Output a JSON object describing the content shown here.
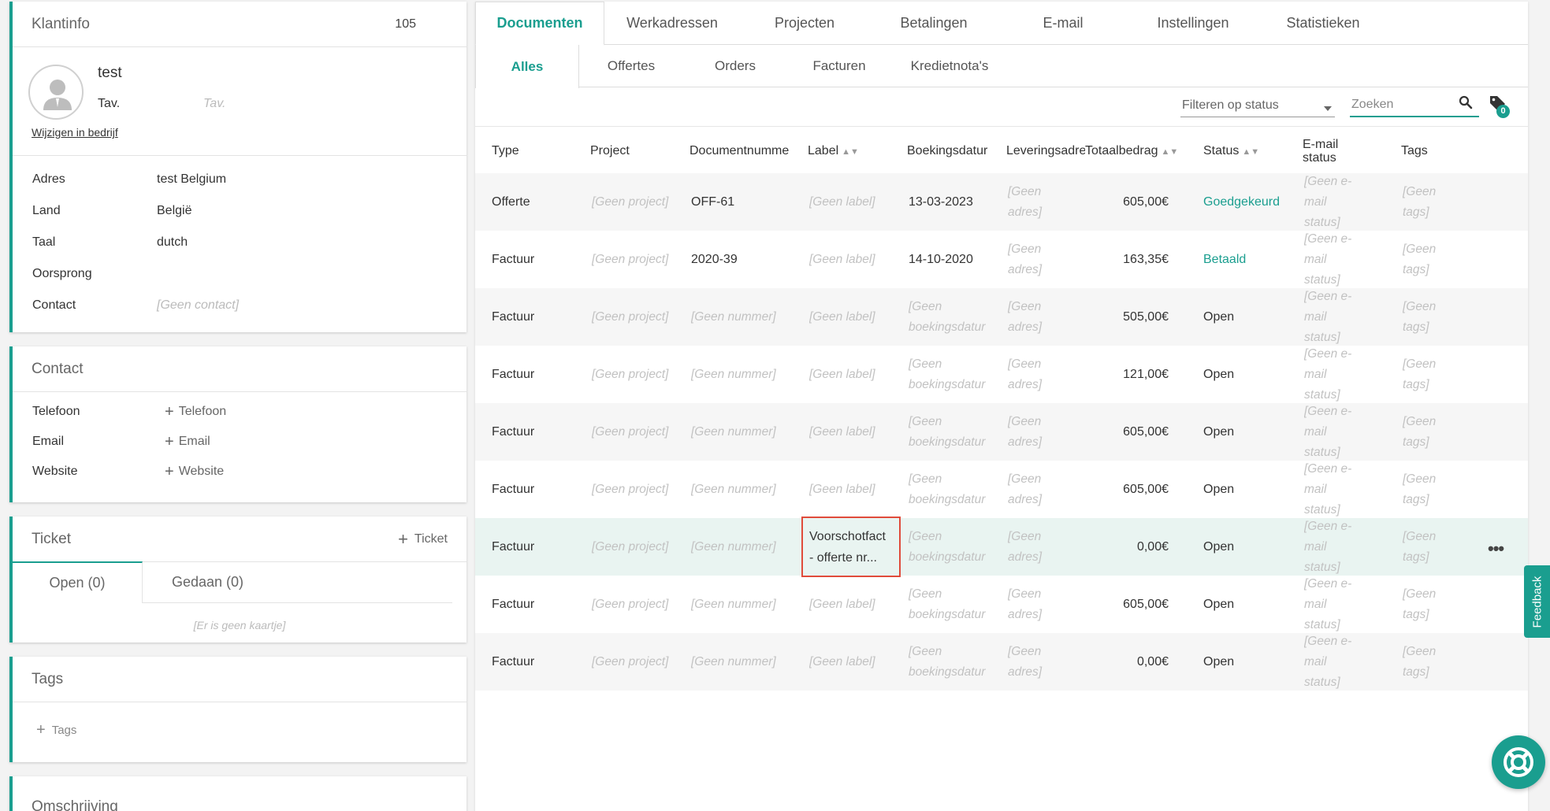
{
  "klantinfo": {
    "title": "Klantinfo",
    "number": "105",
    "name": "test",
    "tav_label": "Tav.",
    "tav_placeholder": "Tav.",
    "change_link": "Wijzigen in bedrijf",
    "fields": [
      {
        "key": "Adres",
        "value": "test Belgium"
      },
      {
        "key": "Land",
        "value": "België"
      },
      {
        "key": "Taal",
        "value": "dutch"
      },
      {
        "key": "Oorsprong",
        "value": ""
      },
      {
        "key": "Contact",
        "value": "[Geen contact]"
      }
    ]
  },
  "contact": {
    "title": "Contact",
    "rows": [
      {
        "key": "Telefoon",
        "add": "Telefoon"
      },
      {
        "key": "Email",
        "add": "Email"
      },
      {
        "key": "Website",
        "add": "Website"
      }
    ]
  },
  "ticket": {
    "title": "Ticket",
    "add_label": "Ticket",
    "tabs": [
      "Open (0)",
      "Gedaan (0)"
    ],
    "empty": "[Er is geen kaartje]"
  },
  "tags": {
    "title": "Tags",
    "add_label": "Tags"
  },
  "omschrijving": {
    "title": "Omschrijving"
  },
  "main_tabs": [
    "Documenten",
    "Werkadressen",
    "Projecten",
    "Betalingen",
    "E-mail",
    "Instellingen",
    "Statistieken"
  ],
  "sub_tabs": [
    "Alles",
    "Offertes",
    "Orders",
    "Facturen",
    "Kredietnota's"
  ],
  "toolbar": {
    "filter_placeholder": "Filteren op status",
    "search_placeholder": "Zoeken",
    "tag_count": "0"
  },
  "table": {
    "headers": [
      "Type",
      "Project",
      "Documentnumme",
      "Label",
      "Boekingsdatur",
      "Leveringsadre",
      "Totaalbedrag",
      "Status",
      "E-mail status",
      "Tags"
    ],
    "rows": [
      {
        "type": "Offerte",
        "project": "[Geen project]",
        "number": "OFF-61",
        "label": "[Geen label]",
        "date": "13-03-2023",
        "address": "[Geen adres]",
        "amount": "605,00€",
        "status": "Goedgekeurd",
        "email": "[Geen e-mail status]",
        "tags": "[Geen tags]"
      },
      {
        "type": "Factuur",
        "project": "[Geen project]",
        "number": "2020-39",
        "label": "[Geen label]",
        "date": "14-10-2020",
        "address": "[Geen adres]",
        "amount": "163,35€",
        "status": "Betaald",
        "email": "[Geen e-mail status]",
        "tags": "[Geen tags]"
      },
      {
        "type": "Factuur",
        "project": "[Geen project]",
        "number": "[Geen nummer]",
        "label": "[Geen label]",
        "date": "[Geen boekingsdatur",
        "address": "[Geen adres]",
        "amount": "505,00€",
        "status": "Open",
        "email": "[Geen e-mail status]",
        "tags": "[Geen tags]"
      },
      {
        "type": "Factuur",
        "project": "[Geen project]",
        "number": "[Geen nummer]",
        "label": "[Geen label]",
        "date": "[Geen boekingsdatur",
        "address": "[Geen adres]",
        "amount": "121,00€",
        "status": "Open",
        "email": "[Geen e-mail status]",
        "tags": "[Geen tags]"
      },
      {
        "type": "Factuur",
        "project": "[Geen project]",
        "number": "[Geen nummer]",
        "label": "[Geen label]",
        "date": "[Geen boekingsdatur",
        "address": "[Geen adres]",
        "amount": "605,00€",
        "status": "Open",
        "email": "[Geen e-mail status]",
        "tags": "[Geen tags]"
      },
      {
        "type": "Factuur",
        "project": "[Geen project]",
        "number": "[Geen nummer]",
        "label": "[Geen label]",
        "date": "[Geen boekingsdatur",
        "address": "[Geen adres]",
        "amount": "605,00€",
        "status": "Open",
        "email": "[Geen e-mail status]",
        "tags": "[Geen tags]"
      },
      {
        "type": "Factuur",
        "project": "[Geen project]",
        "number": "[Geen nummer]",
        "label": "Voorschotfact - offerte nr...",
        "date": "[Geen boekingsdatur",
        "address": "[Geen adres]",
        "amount": "0,00€",
        "status": "Open",
        "email": "[Geen e-mail status]",
        "tags": "[Geen tags]"
      },
      {
        "type": "Factuur",
        "project": "[Geen project]",
        "number": "[Geen nummer]",
        "label": "[Geen label]",
        "date": "[Geen boekingsdatur",
        "address": "[Geen adres]",
        "amount": "605,00€",
        "status": "Open",
        "email": "[Geen e-mail status]",
        "tags": "[Geen tags]"
      },
      {
        "type": "Factuur",
        "project": "[Geen project]",
        "number": "[Geen nummer]",
        "label": "[Geen label]",
        "date": "[Geen boekingsdatur",
        "address": "[Geen adres]",
        "amount": "0,00€",
        "status": "Open",
        "email": "[Geen e-mail status]",
        "tags": "[Geen tags]"
      }
    ]
  },
  "feedback_label": "Feedback",
  "colors": {
    "accent": "#1a9e8f",
    "highlight_border": "#e04b3b",
    "row_highlight": "#e9f4f1"
  }
}
